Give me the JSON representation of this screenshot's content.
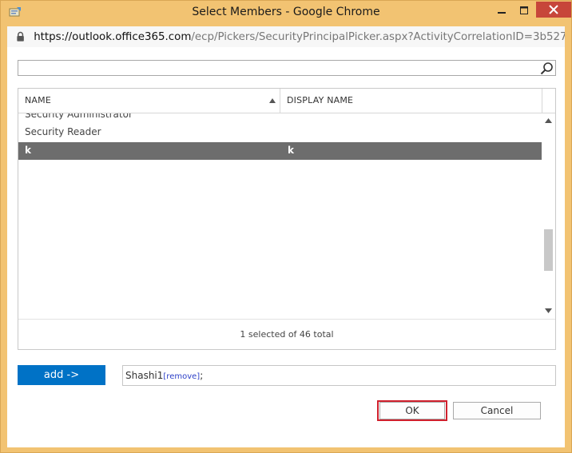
{
  "window": {
    "title": "Select Members - Google Chrome",
    "colors": {
      "frame": "#f2c372",
      "close": "#c7463a"
    }
  },
  "urlbar": {
    "host": "https://outlook.office365.com",
    "path": "/ecp/Pickers/SecurityPrincipalPicker.aspx?ActivityCorrelationID=3b527563..."
  },
  "search": {
    "value": "",
    "placeholder": ""
  },
  "grid": {
    "columns": {
      "name": "NAME",
      "display_name": "DISPLAY NAME"
    },
    "rows": [
      {
        "name": "Security Administrator",
        "display_name": ""
      },
      {
        "name": "Security Reader",
        "display_name": ""
      },
      {
        "name": "k",
        "display_name": "k",
        "selected": true
      }
    ],
    "status": "1 selected of 46 total"
  },
  "add": {
    "label": "add ->",
    "color": "#0072c6"
  },
  "members": {
    "name": "Shashi1",
    "remove": "[remove]",
    "separator": ";"
  },
  "buttons": {
    "ok": "OK",
    "cancel": "Cancel",
    "highlight": "#d0202d"
  }
}
